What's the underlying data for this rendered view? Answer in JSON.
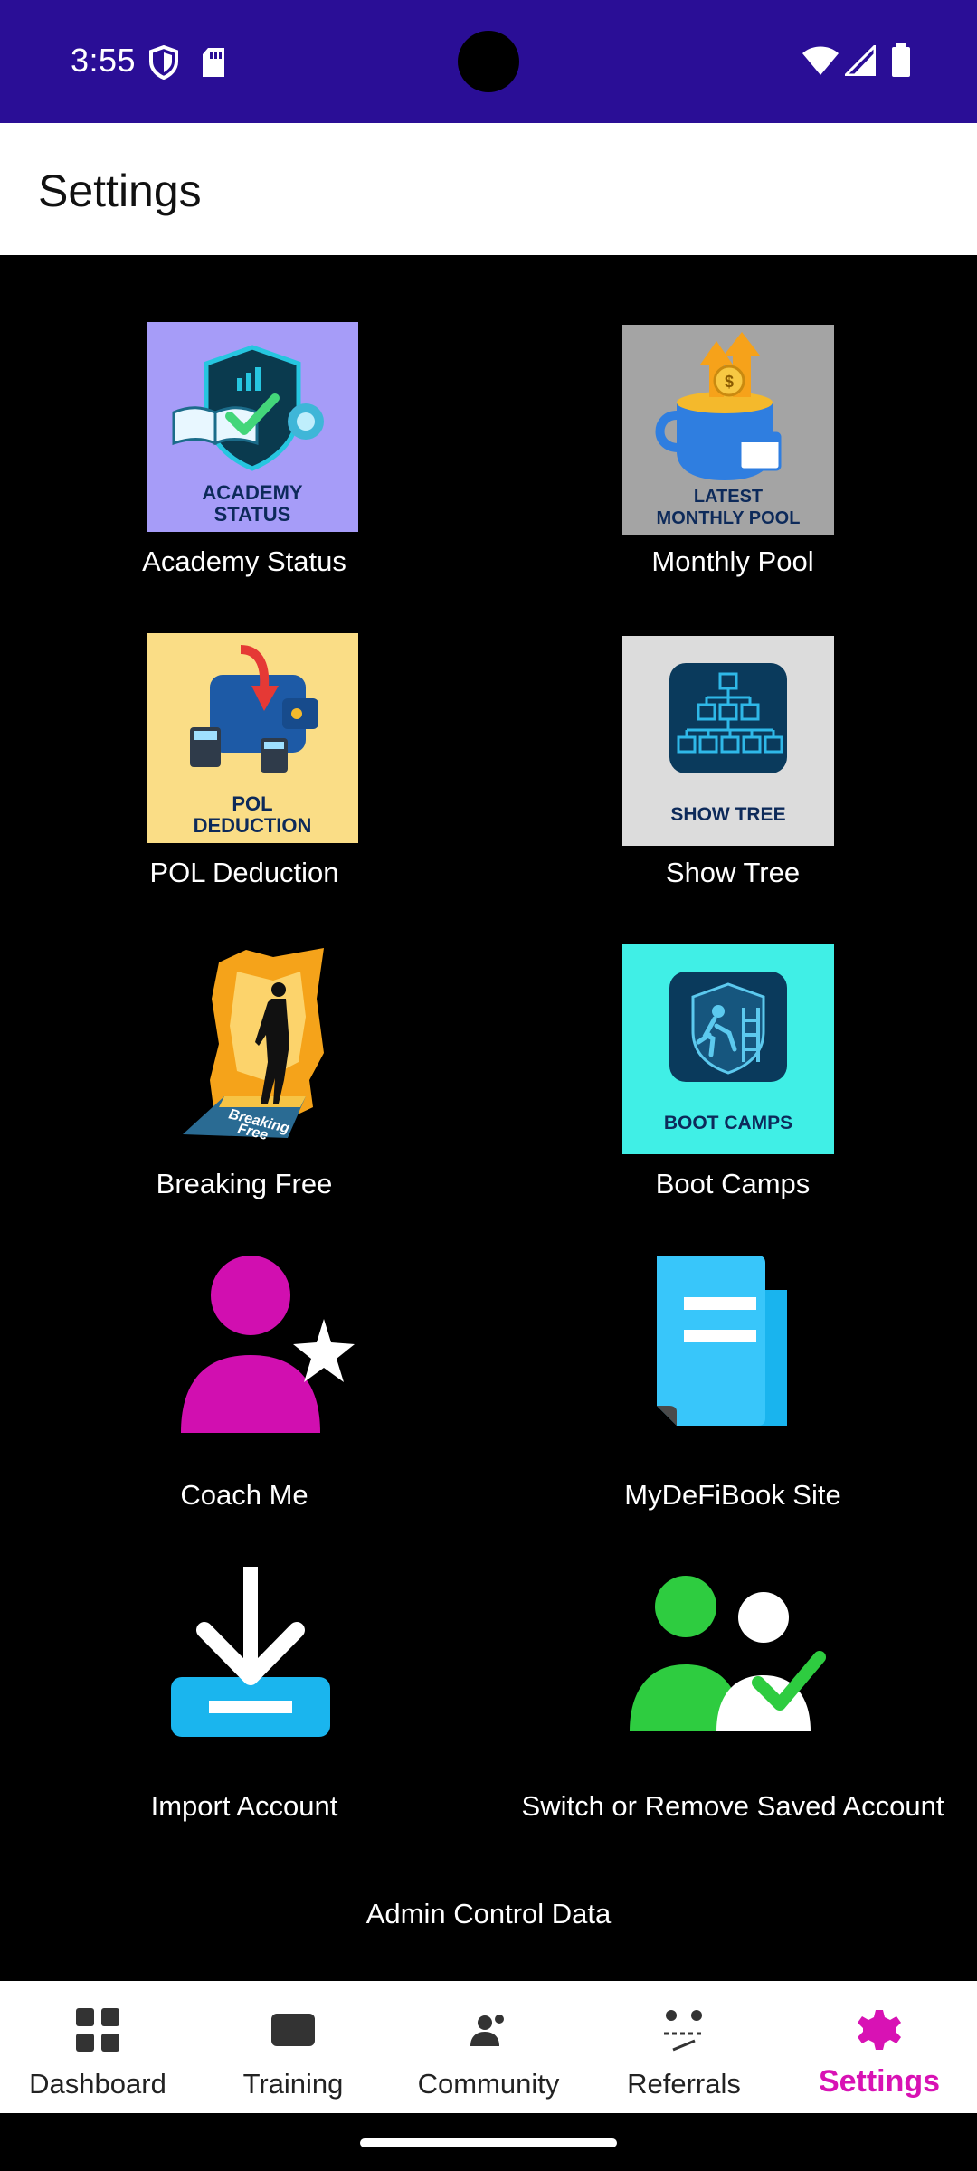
{
  "status_bar": {
    "time": "3:55"
  },
  "app_bar": {
    "title": "Settings"
  },
  "tiles": [
    {
      "label": "Academy Status",
      "image_text_1": "ACADEMY",
      "image_text_2": "STATUS"
    },
    {
      "label": "Monthly Pool",
      "image_text_1": "LATEST",
      "image_text_2": "MONTHLY POOL"
    },
    {
      "label": "POL Deduction",
      "image_text_1": "POL",
      "image_text_2": "DEDUCTION"
    },
    {
      "label": "Show Tree",
      "image_text_1": "SHOW TREE"
    },
    {
      "label": "Breaking Free",
      "image_text_1": "Breaking",
      "image_text_2": "Free"
    },
    {
      "label": "Boot Camps",
      "image_text_1": "BOOT CAMPS"
    },
    {
      "label": "Coach Me"
    },
    {
      "label": "MyDeFiBook Site"
    },
    {
      "label": "Import Account"
    },
    {
      "label": "Switch or Remove Saved Account"
    }
  ],
  "admin": {
    "label": "Admin Control Data"
  },
  "bottom_nav": {
    "items": [
      {
        "label": "Dashboard",
        "icon": "dashboard-icon"
      },
      {
        "label": "Training",
        "icon": "training-icon"
      },
      {
        "label": "Community",
        "icon": "community-icon"
      },
      {
        "label": "Referrals",
        "icon": "referrals-icon"
      },
      {
        "label": "Settings",
        "icon": "settings-icon"
      }
    ],
    "active_index": 4
  },
  "colors": {
    "status_bar": "#2a0e96",
    "accent": "#d812b4",
    "background": "#000000"
  }
}
